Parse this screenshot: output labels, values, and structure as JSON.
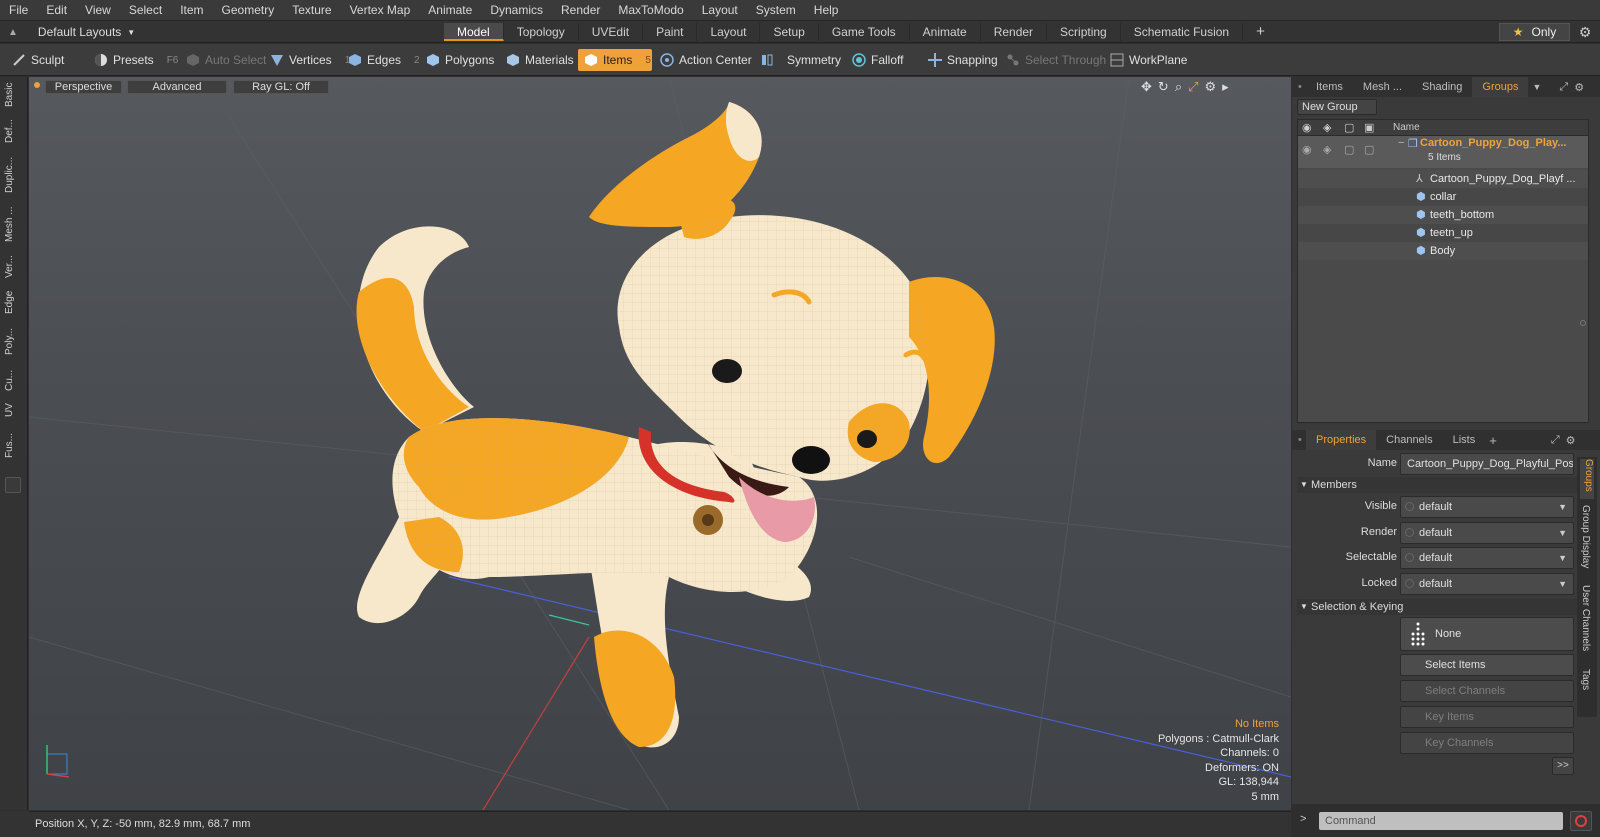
{
  "menu": [
    "File",
    "Edit",
    "View",
    "Select",
    "Item",
    "Geometry",
    "Texture",
    "Vertex Map",
    "Animate",
    "Dynamics",
    "Render",
    "MaxToModo",
    "Layout",
    "System",
    "Help"
  ],
  "layouts": {
    "label": "Default Layouts"
  },
  "tabs": [
    "Model",
    "Topology",
    "UVEdit",
    "Paint",
    "Layout",
    "Setup",
    "Game Tools",
    "Animate",
    "Render",
    "Scripting",
    "Schematic Fusion"
  ],
  "only_label": "Only",
  "toolbar": {
    "sculpt": "Sculpt",
    "presets": "Presets",
    "presets_key": "F6",
    "auto_select": "Auto Select",
    "vertices": "Vertices",
    "vertices_key": "1",
    "edges": "Edges",
    "edges_key": "2",
    "polygons": "Polygons",
    "materials": "Materials",
    "items": "Items",
    "items_key": "5",
    "action_center": "Action Center",
    "symmetry": "Symmetry",
    "falloff": "Falloff",
    "snapping": "Snapping",
    "select_through": "Select Through",
    "workplane": "WorkPlane"
  },
  "left_tabs": [
    "Basic",
    "Def...",
    "Duplic...",
    "Mesh ...",
    "Ver...",
    "Edge",
    "Poly...",
    "Cu...",
    "UV",
    "Fus..."
  ],
  "viewport": {
    "view": "Perspective",
    "advanced": "Advanced",
    "raygl": "Ray GL: Off",
    "hud": {
      "status": "No Items",
      "polygons": "Polygons : Catmull-Clark",
      "channels": "Channels: 0",
      "deformers": "Deformers: ON",
      "gl": "GL: 138,944",
      "scale": "5 mm"
    }
  },
  "status": {
    "position": "Position X, Y, Z:  -50 mm, 82.9 mm, 68.7 mm"
  },
  "right_tabs": [
    "Items",
    "Mesh ...",
    "Shading",
    "Groups"
  ],
  "groups": {
    "new_group": "New Group",
    "name_header": "Name",
    "group_name": "Cartoon_Puppy_Dog_Play...",
    "group_count": "5 Items",
    "items": [
      "Cartoon_Puppy_Dog_Playf ...",
      "collar",
      "teeth_bottom",
      "teetn_up",
      "Body"
    ]
  },
  "props_tabs": [
    "Properties",
    "Channels",
    "Lists"
  ],
  "properties": {
    "name_label": "Name",
    "name_value": "Cartoon_Puppy_Dog_Playful_Pos",
    "members": "Members",
    "visible_label": "Visible",
    "visible": "default",
    "render_label": "Render",
    "render": "default",
    "selectable_label": "Selectable",
    "selectable": "default",
    "locked_label": "Locked",
    "locked": "default",
    "sel_keying": "Selection & Keying",
    "none": "None",
    "select_items": "Select Items",
    "select_channels": "Select Channels",
    "key_items": "Key Items",
    "key_channels": "Key Channels",
    "more": ">>"
  },
  "right_vtabs": [
    "Groups",
    "Group Display",
    "User Channels",
    "Tags"
  ],
  "command": {
    "placeholder": "Command"
  },
  "colors": {
    "accent": "#f0a23a",
    "fur": "#f7e8cc",
    "spots": "#f5a623"
  }
}
